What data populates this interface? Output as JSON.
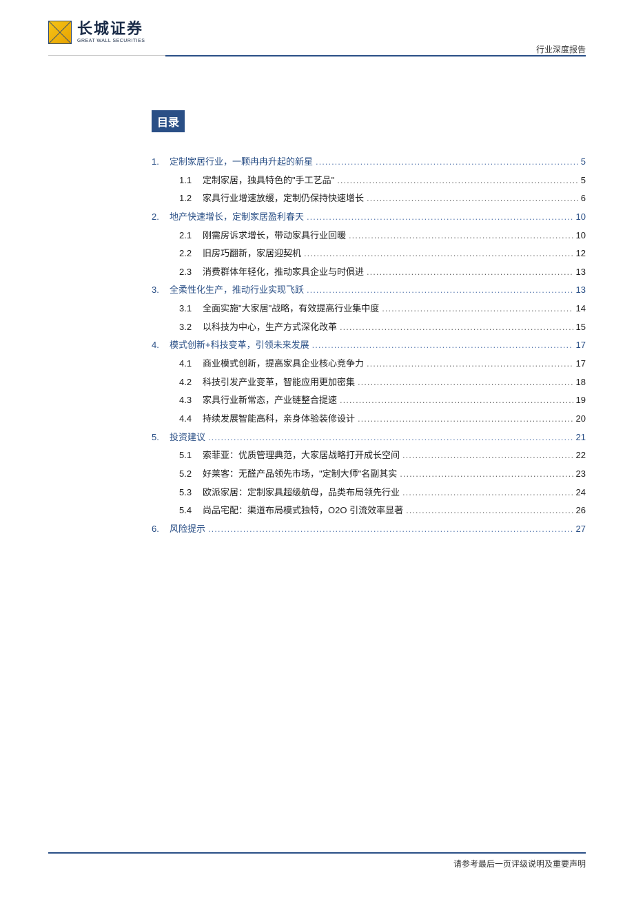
{
  "header": {
    "logo_cn": "长城证券",
    "logo_en": "GREAT WALL SECURITIES",
    "doc_type": "行业深度报告"
  },
  "toc_title": "目录",
  "toc": [
    {
      "level": 1,
      "num": "1.",
      "label": "定制家居行业，一颗冉冉升起的新星",
      "page": "5"
    },
    {
      "level": 2,
      "num": "1.1",
      "label": "定制家居，独具特色的\"手工艺品\"",
      "page": "5"
    },
    {
      "level": 2,
      "num": "1.2",
      "label": "家具行业增速放缓，定制仍保持快速增长",
      "page": "6"
    },
    {
      "level": 1,
      "num": "2.",
      "label": "地产快速增长，定制家居盈利春天",
      "page": "10"
    },
    {
      "level": 2,
      "num": "2.1",
      "label": "刚需房诉求增长，带动家具行业回暖",
      "page": "10"
    },
    {
      "level": 2,
      "num": "2.2",
      "label": "旧房巧翻新，家居迎契机",
      "page": "12"
    },
    {
      "level": 2,
      "num": "2.3",
      "label": "消费群体年轻化，推动家具企业与时俱进",
      "page": "13"
    },
    {
      "level": 1,
      "num": "3.",
      "label": "全柔性化生产，推动行业实现飞跃",
      "page": "13"
    },
    {
      "level": 2,
      "num": "3.1",
      "label": "全面实施\"大家居\"战略，有效提高行业集中度",
      "page": "14"
    },
    {
      "level": 2,
      "num": "3.2",
      "label": "以科技为中心，生产方式深化改革",
      "page": "15"
    },
    {
      "level": 1,
      "num": "4.",
      "label": "模式创新+科技变革，引领未来发展",
      "page": "17"
    },
    {
      "level": 2,
      "num": "4.1",
      "label": "商业模式创新，提高家具企业核心竞争力",
      "page": "17"
    },
    {
      "level": 2,
      "num": "4.2",
      "label": "科技引发产业变革，智能应用更加密集",
      "page": "18"
    },
    {
      "level": 2,
      "num": "4.3",
      "label": "家具行业新常态，产业链整合提速",
      "page": "19"
    },
    {
      "level": 2,
      "num": "4.4",
      "label": "持续发展智能高科，亲身体验装修设计",
      "page": "20"
    },
    {
      "level": 1,
      "num": "5.",
      "label": "投资建议",
      "page": "21"
    },
    {
      "level": 2,
      "num": "5.1",
      "label": "索菲亚：优质管理典范，大家居战略打开成长空间",
      "page": "22"
    },
    {
      "level": 2,
      "num": "5.2",
      "label": "好莱客：无醛产品领先市场，\"定制大师\"名副其实",
      "page": "23"
    },
    {
      "level": 2,
      "num": "5.3",
      "label": "欧派家居：定制家具超级航母，品类布局领先行业",
      "page": "24"
    },
    {
      "level": 2,
      "num": "5.4",
      "label": "尚品宅配：渠道布局模式独特，O2O 引流效率显著",
      "page": "26"
    },
    {
      "level": 1,
      "num": "6.",
      "label": "风险提示",
      "page": "27"
    }
  ],
  "footer": "请参考最后一页评级说明及重要声明"
}
